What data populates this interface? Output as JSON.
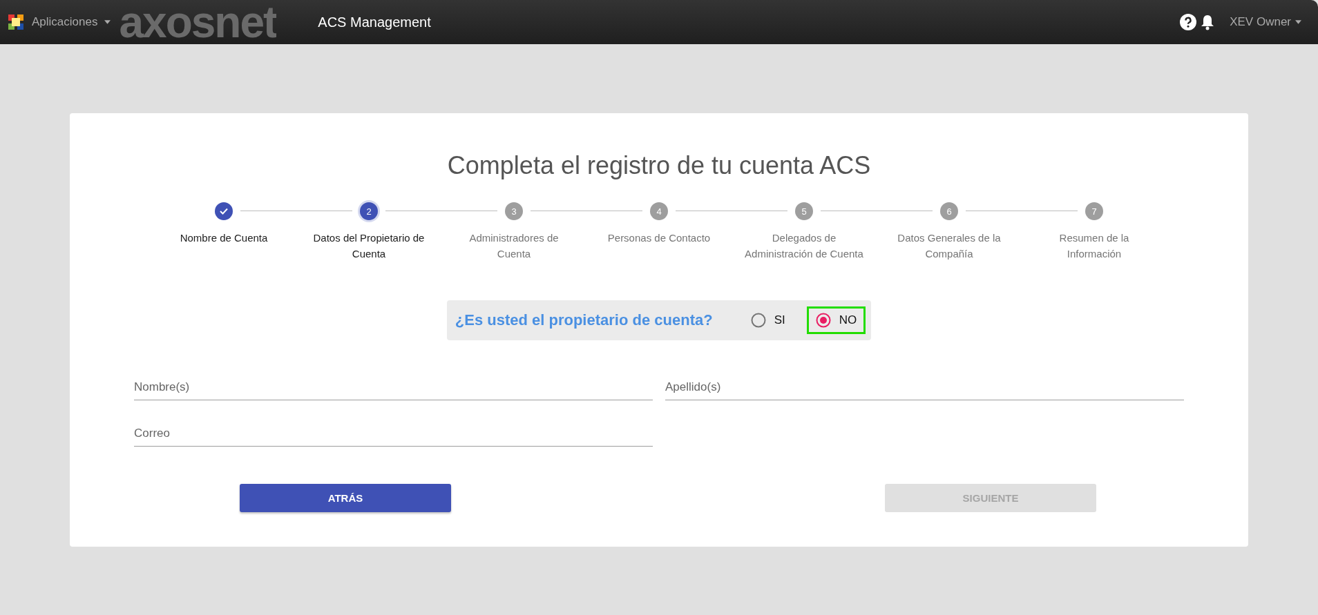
{
  "navbar": {
    "apps_menu": "Aplicaciones",
    "brand": "axosnet",
    "title": "ACS Management",
    "user_menu": "XEV Owner"
  },
  "heading": "Completa el registro de tu cuenta ACS",
  "steps": [
    {
      "label": "Nombre de Cuenta",
      "completed": true,
      "selected": false
    },
    {
      "number": "2",
      "label": "Datos del Propietario de Cuenta",
      "completed": false,
      "selected": true
    },
    {
      "number": "3",
      "label": "Administradores de Cuenta",
      "completed": false,
      "selected": false
    },
    {
      "number": "4",
      "label": "Personas de Contacto",
      "completed": false,
      "selected": false
    },
    {
      "number": "5",
      "label": "Delegados de Administración de Cuenta",
      "completed": false,
      "selected": false
    },
    {
      "number": "6",
      "label": "Datos Generales de la Compañía",
      "completed": false,
      "selected": false
    },
    {
      "number": "7",
      "label": "Resumen de la Información",
      "completed": false,
      "selected": false
    }
  ],
  "owner_question": {
    "label": "¿Es usted el propietario de cuenta?",
    "options": [
      {
        "label": "SI",
        "selected": false
      },
      {
        "label": "NO",
        "selected": true
      }
    ]
  },
  "fields": [
    {
      "placeholder": "Nombre(s)"
    },
    {
      "placeholder": "Apellido(s)"
    },
    {
      "placeholder": "Correo"
    }
  ],
  "buttons": [
    {
      "label": "ATRÁS",
      "disabled": false
    },
    {
      "label": "SIGUIENTE",
      "disabled": true
    }
  ]
}
